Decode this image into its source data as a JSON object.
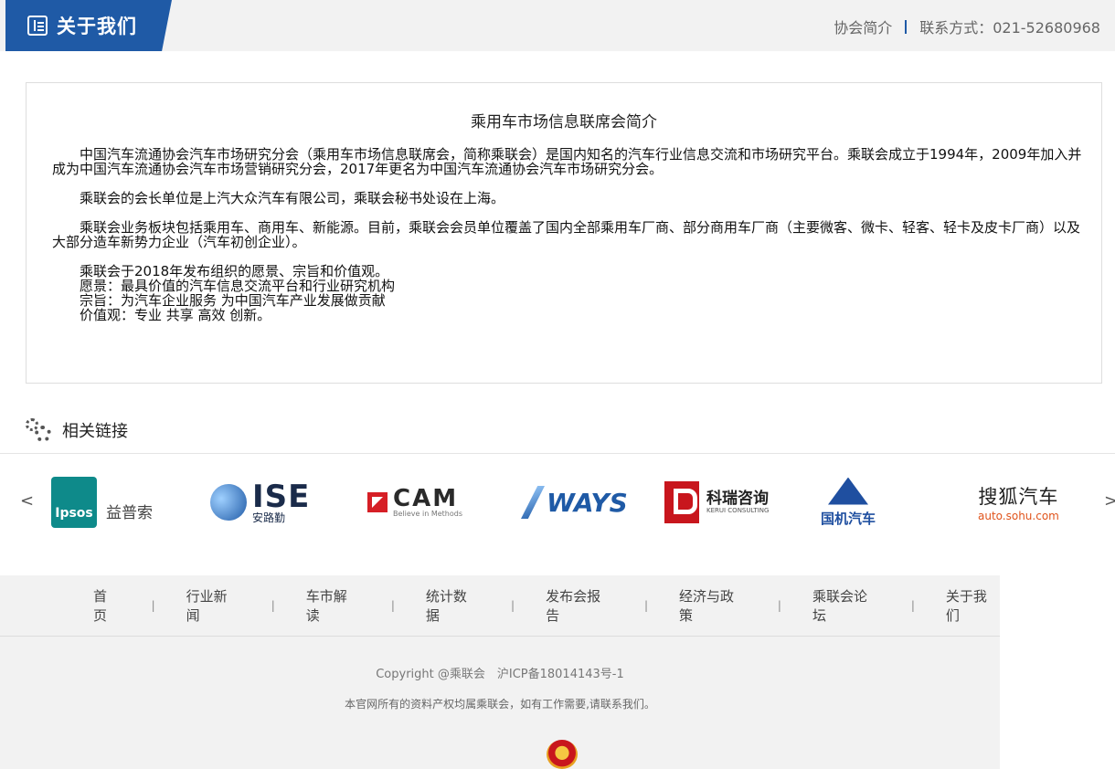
{
  "header": {
    "tab_title": "关于我们",
    "nav_intro": "协会简介",
    "contact": "联系方式：021-52680968"
  },
  "intro": {
    "title": "乘用车市场信息联席会简介",
    "para1": "中国汽车流通协会汽车市场研究分会（乘用车市场信息联席会，简称乘联会）是国内知名的汽车行业信息交流和市场研究平台。乘联会成立于1994年，2009年加入并成为中国汽车流通协会汽车市场营销研究分会，2017年更名为中国汽车流通协会汽车市场研究分会。",
    "para2": "乘联会的会长单位是上汽大众汽车有限公司，乘联会秘书处设在上海。",
    "para3": "乘联会业务板块包括乘用车、商用车、新能源。目前，乘联会会员单位覆盖了国内全部乘用车厂商、部分商用车厂商（主要微客、微卡、轻客、轻卡及皮卡厂商）以及大部分造车新势力企业（汽车初创企业）。",
    "lines": [
      "乘联会于2018年发布组织的愿景、宗旨和价值观。",
      "愿景：最具价值的汽车信息交流平台和行业研究机构",
      "宗旨：为汽车企业服务 为中国汽车产业发展做贡献",
      "价值观：专业 共享 高效 创新。"
    ]
  },
  "links": {
    "title": "相关链接",
    "prev": "<",
    "next": ">",
    "logos": {
      "ipsos_mark": "Ipsos",
      "ipsos_label": "益普索",
      "ise_big": "ISE",
      "ise_small": "安路勤",
      "cam_big": "CAM",
      "cam_small": "Believe in Methods",
      "ways": "WAYS",
      "kerui_big": "科瑞咨询",
      "kerui_small": "KERUI CONSULTING",
      "guoji": "国机汽车",
      "sohu_big": "搜狐汽车",
      "sohu_small": "auto.sohu.com"
    }
  },
  "footer": {
    "nav": [
      "首页",
      "行业新闻",
      "车市解读",
      "统计数据",
      "发布会报告",
      "经济与政策",
      "乘联会论坛",
      "关于我们"
    ],
    "separator": "|",
    "copyright": "Copyright @乘联会　沪ICP备18014143号-1",
    "rights": "本官网所有的资料产权均属乘联会，如有工作需要,请联系我们。"
  },
  "colors": {
    "brand_blue": "#1f5aa6",
    "footer_bg": "#f2f2f2"
  }
}
